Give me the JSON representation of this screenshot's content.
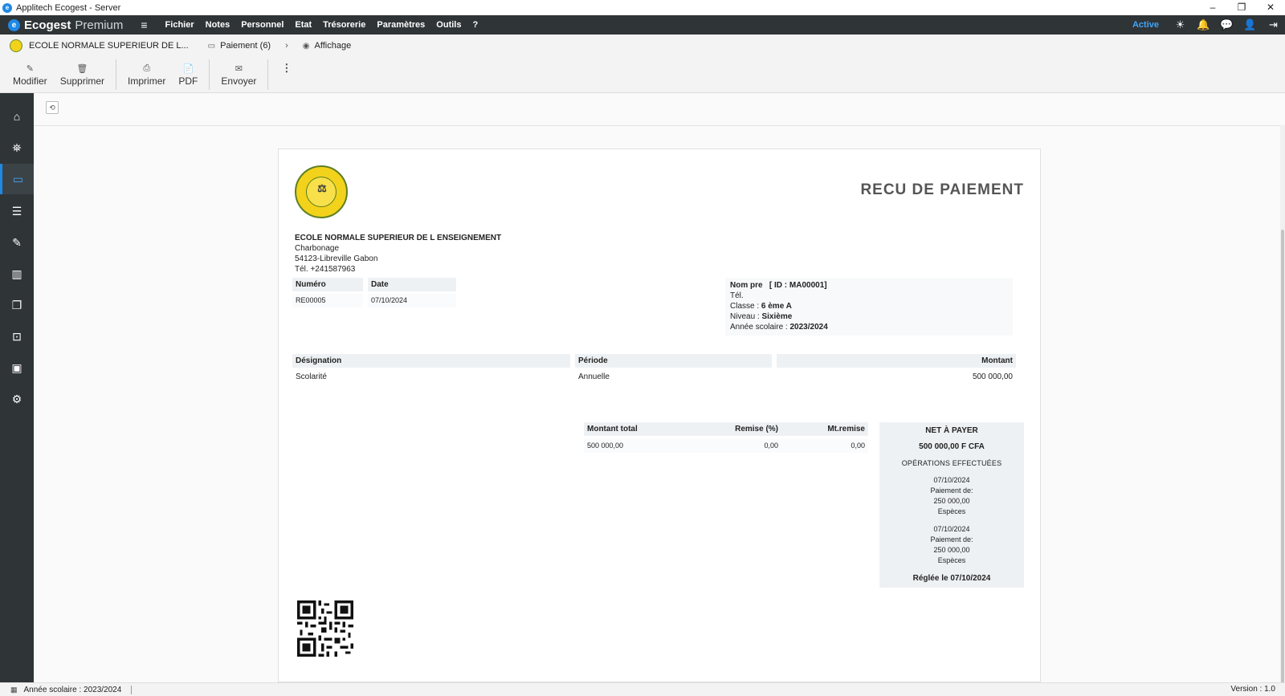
{
  "window": {
    "title": "Applitech Ecogest - Server",
    "controls": {
      "minimize": "–",
      "restore": "❐",
      "close": "✕"
    }
  },
  "menubar": {
    "brand_icon": "e",
    "brand_name": "Ecogest",
    "brand_sub": "Premium",
    "hamburger": "≡",
    "items": [
      "Fichier",
      "Notes",
      "Personnel",
      "Etat",
      "Trésorerie",
      "Paramètres",
      "Outils",
      "?"
    ],
    "status": "Active",
    "icons": [
      "sun-icon",
      "bell-icon",
      "chat-icon",
      "user-icon",
      "logout-icon"
    ],
    "icon_glyphs": [
      "☀",
      "🔔",
      "💬",
      "👤",
      "⇥"
    ]
  },
  "breadcrumb": {
    "school": "ECOLE NORMALE SUPERIEUR DE L...",
    "section_icon": "▭",
    "section": "Paiement (6)",
    "chevron": "›",
    "view_icon": "◉",
    "view": "Affichage"
  },
  "toolbar": {
    "edit": {
      "label": "Modifier",
      "glyph": "✎"
    },
    "delete": {
      "label": "Supprimer",
      "glyph": "🗑"
    },
    "print": {
      "label": "Imprimer",
      "glyph": "⎙"
    },
    "pdf": {
      "label": "PDF",
      "glyph": "📄"
    },
    "send": {
      "label": "Envoyer",
      "glyph": "✉"
    },
    "more": "⋮"
  },
  "sidebar": {
    "items": [
      {
        "name": "home-icon",
        "glyph": "⌂"
      },
      {
        "name": "graduation-icon",
        "glyph": "⛯"
      },
      {
        "name": "payment-card-icon",
        "glyph": "▭"
      },
      {
        "name": "list-icon",
        "glyph": "☰"
      },
      {
        "name": "pencil-icon",
        "glyph": "✎"
      },
      {
        "name": "chart-icon",
        "glyph": "▥"
      },
      {
        "name": "book-icon",
        "glyph": "❐"
      },
      {
        "name": "presentation-icon",
        "glyph": "⊡"
      },
      {
        "name": "wallet-icon",
        "glyph": "▣"
      },
      {
        "name": "settings-icon",
        "glyph": "⚙"
      }
    ],
    "active_index": 2
  },
  "content": {
    "back_glyph": "⟲"
  },
  "receipt": {
    "title": "RECU DE PAIEMENT",
    "seal_glyph": "⚖",
    "school": {
      "name": "ECOLE NORMALE SUPERIEUR DE L ENSEIGNEMENT",
      "address1": "Charbonage",
      "address2": "54123-Libreville Gabon",
      "phone": "Tél. +241587963"
    },
    "meta": {
      "headers": [
        "Numéro",
        "Date"
      ],
      "values": [
        "RE00005",
        "07/10/2024"
      ]
    },
    "student": {
      "name_label": "Nom pre",
      "id": "[ ID : MA00001]",
      "phone_label": "Tél.",
      "class_label": "Classe :",
      "class_value": "6 ème A",
      "level_label": "Niveau :",
      "level_value": "Sixième",
      "year_label": "Année scolaire :",
      "year_value": "2023/2024"
    },
    "lines": {
      "headers": [
        "Désignation",
        "Période",
        "Montant"
      ],
      "rows": [
        [
          "Scolarité",
          "Annuelle",
          "500 000,00"
        ]
      ]
    },
    "totals": {
      "headers": [
        "Montant total",
        "Remise (%)",
        "Mt.remise"
      ],
      "values": [
        "500 000,00",
        "0,00",
        "0,00"
      ]
    },
    "net": {
      "title": "NET À PAYER",
      "amount": "500 000,00 F CFA",
      "ops_title": "OPÉRATIONS EFFECTUÉES",
      "operations": [
        {
          "date": "07/10/2024",
          "label": "Paiement de:",
          "amount": "250 000,00",
          "method": "Espèces"
        },
        {
          "date": "07/10/2024",
          "label": "Paiement de:",
          "amount": "250 000,00",
          "method": "Espèces"
        }
      ],
      "settled": "Réglée le 07/10/2024"
    }
  },
  "statusbar": {
    "calendar_glyph": "▦",
    "year": "Année scolaire : 2023/2024",
    "version": "Version : 1.0"
  }
}
